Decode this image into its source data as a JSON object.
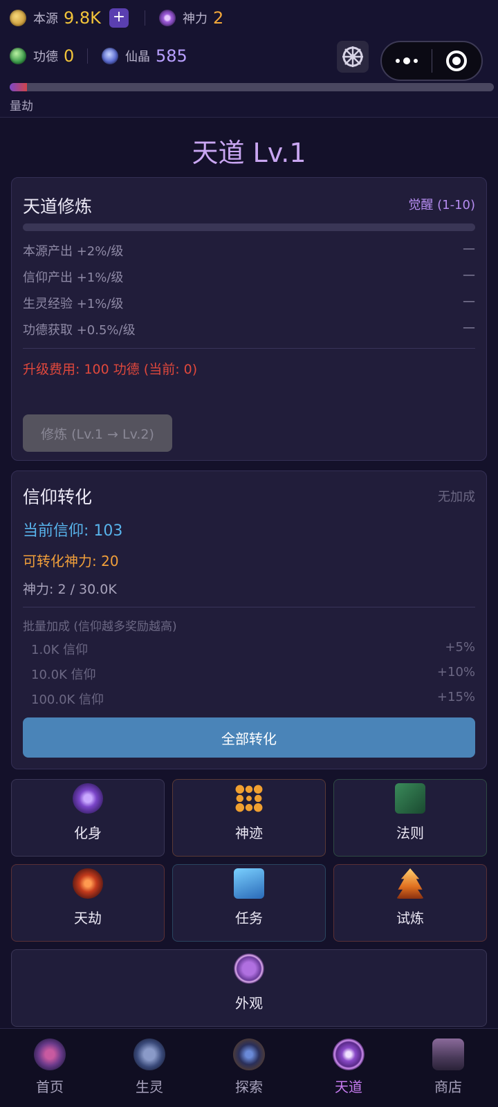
{
  "resources": {
    "benyuan": {
      "label": "本源",
      "value": "9.8K",
      "color": "#f2c43a",
      "icon": "benyuan-coin-icon"
    },
    "plus": "+",
    "shenli": {
      "label": "神力",
      "value": "2",
      "color": "#f2a73a",
      "icon": "shenli-orb-icon"
    },
    "gongde": {
      "label": "功德",
      "value": "0",
      "color": "#f2c43a",
      "icon": "gongde-orb-icon"
    },
    "xianjing": {
      "label": "仙晶",
      "value": "585",
      "color": "#b9a0ff",
      "icon": "xianjing-crystal-icon"
    }
  },
  "kalpa": {
    "label": "量劫",
    "progress": 0.036
  },
  "title": "天道 Lv.1",
  "cultivation": {
    "heading": "天道修炼",
    "stage": "觉醒 (1-10)",
    "progress": 0,
    "stats": [
      {
        "label": "本源产出 +2%/级",
        "value": "—"
      },
      {
        "label": "信仰产出 +1%/级",
        "value": "—"
      },
      {
        "label": "生灵经验 +1%/级",
        "value": "—"
      },
      {
        "label": "功德获取 +0.5%/级",
        "value": "—"
      }
    ],
    "cost": "升级费用: 100 功德 (当前: 0)",
    "button": "修炼 (Lv.1 → Lv.2)"
  },
  "faith": {
    "heading": "信仰转化",
    "bonus_status": "无加成",
    "current": "当前信仰: 103",
    "convertible": "可转化神力: 20",
    "divine": "神力: 2 / 30.0K",
    "batch_title": "批量加成 (信仰越多奖励越高)",
    "tiers": [
      {
        "label": "1.0K 信仰",
        "bonus": "+5%"
      },
      {
        "label": "10.0K 信仰",
        "bonus": "+10%"
      },
      {
        "label": "100.0K 信仰",
        "bonus": "+15%"
      }
    ],
    "button": "全部转化"
  },
  "tiles": [
    {
      "label": "化身",
      "icon": "avatar-sigil-icon"
    },
    {
      "label": "神迹",
      "icon": "miracle-gems-icon"
    },
    {
      "label": "法则",
      "icon": "law-book-icon"
    },
    {
      "label": "天劫",
      "icon": "tribulation-icon"
    },
    {
      "label": "任务",
      "icon": "quest-scroll-icon"
    },
    {
      "label": "试炼",
      "icon": "trial-pagoda-icon"
    },
    {
      "label": "外观",
      "icon": "appearance-icon"
    }
  ],
  "nav": [
    {
      "label": "首页",
      "icon": "home-palace-icon"
    },
    {
      "label": "生灵",
      "icon": "creature-dragon-icon"
    },
    {
      "label": "探索",
      "icon": "explore-compass-icon"
    },
    {
      "label": "天道",
      "icon": "tiandao-yinyang-icon"
    },
    {
      "label": "商店",
      "icon": "shop-chest-icon"
    }
  ]
}
